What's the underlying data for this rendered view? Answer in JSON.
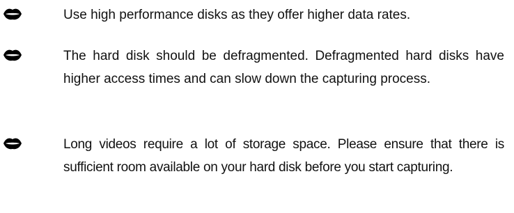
{
  "bullets": [
    {
      "icon": "lips-bullet-icon",
      "text": "Use high performance disks as they offer higher data rates."
    },
    {
      "icon": "lips-bullet-icon",
      "text": "The hard disk should be defragmented. Defragmented hard disks have higher access times and can slow down the capturing process."
    },
    {
      "icon": "lips-bullet-icon",
      "text": "Long videos require a lot of storage space. Please ensure that there is sufficient room available on your hard disk before you start capturing."
    }
  ]
}
